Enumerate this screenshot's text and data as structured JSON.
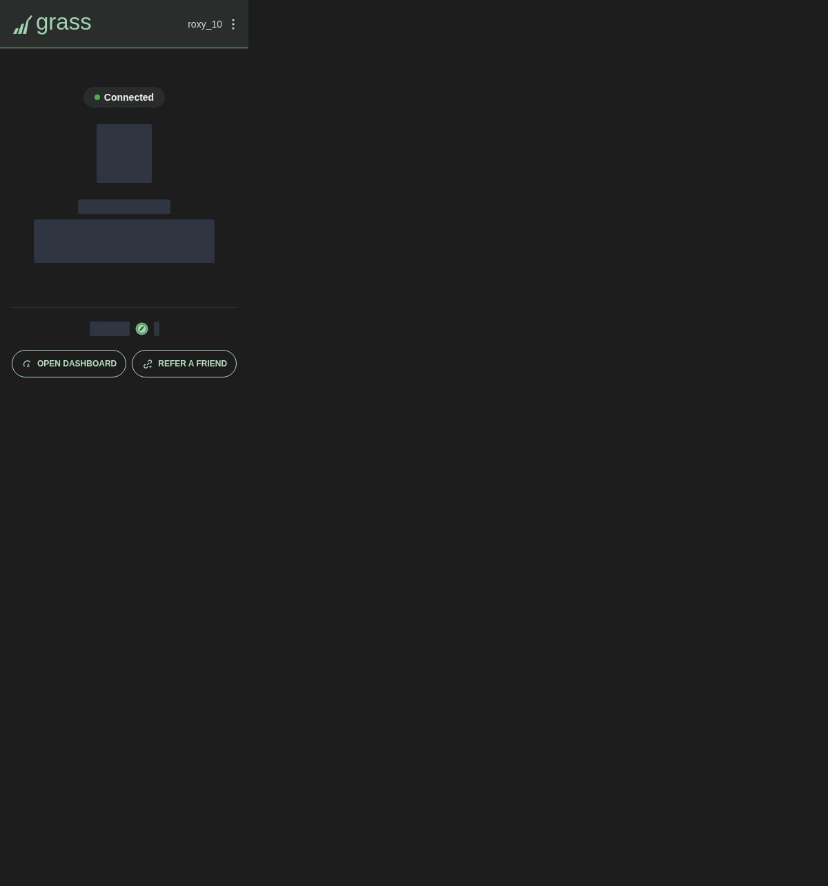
{
  "header": {
    "logo": "grass",
    "username": "roxy_10"
  },
  "status": {
    "label": "Connected",
    "color": "#4caf50"
  },
  "buttons": [
    {
      "label": "OPEN DASHBOARD",
      "kind": "dashboard"
    },
    {
      "label": "REFER A FRIEND",
      "kind": "refer"
    }
  ]
}
